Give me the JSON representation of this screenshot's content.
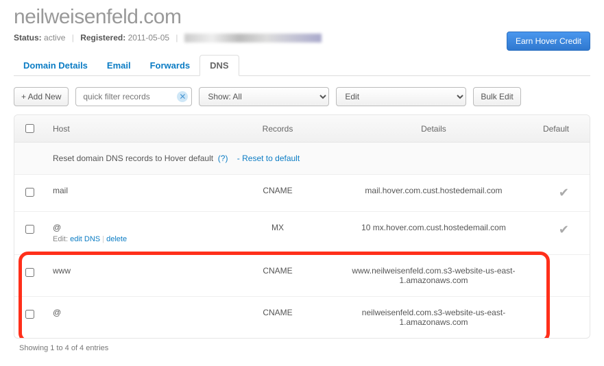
{
  "page": {
    "title": "neilweisenfeld.com",
    "status_label": "Status:",
    "status_value": "active",
    "registered_label": "Registered:",
    "registered_value": "2011-05-05",
    "credit_button": "Earn Hover Credit"
  },
  "tabs": [
    {
      "label": "Domain Details",
      "active": false
    },
    {
      "label": "Email",
      "active": false
    },
    {
      "label": "Forwards",
      "active": false
    },
    {
      "label": "DNS",
      "active": true
    }
  ],
  "toolbar": {
    "add_new": "+ Add New",
    "filter_placeholder": "quick filter records",
    "show_select": "Show: All",
    "edit_select": "Edit",
    "bulk_edit": "Bulk Edit"
  },
  "table": {
    "headers": {
      "host": "Host",
      "records": "Records",
      "details": "Details",
      "default": "Default"
    },
    "reset_text": "Reset domain DNS records to Hover default",
    "reset_help": "(?)",
    "reset_link": "- Reset to default",
    "rows": [
      {
        "host": "mail",
        "record": "CNAME",
        "details": "mail.hover.com.cust.hostedemail.com",
        "default": true,
        "highlight": false
      },
      {
        "host": "@",
        "record": "MX",
        "details": "10 mx.hover.com.cust.hostedemail.com",
        "default": true,
        "highlight": false,
        "edit_row": {
          "prefix": "Edit:",
          "edit": "edit DNS",
          "delete": "delete"
        }
      },
      {
        "host": "www",
        "record": "CNAME",
        "details": "www.neilweisenfeld.com.s3-website-us-east-1.amazonaws.com",
        "default": false,
        "highlight": true
      },
      {
        "host": "@",
        "record": "CNAME",
        "details": "neilweisenfeld.com.s3-website-us-east-1.amazonaws.com",
        "default": false,
        "highlight": true
      }
    ]
  },
  "footer": {
    "showing": "Showing 1 to 4 of 4 entries"
  }
}
